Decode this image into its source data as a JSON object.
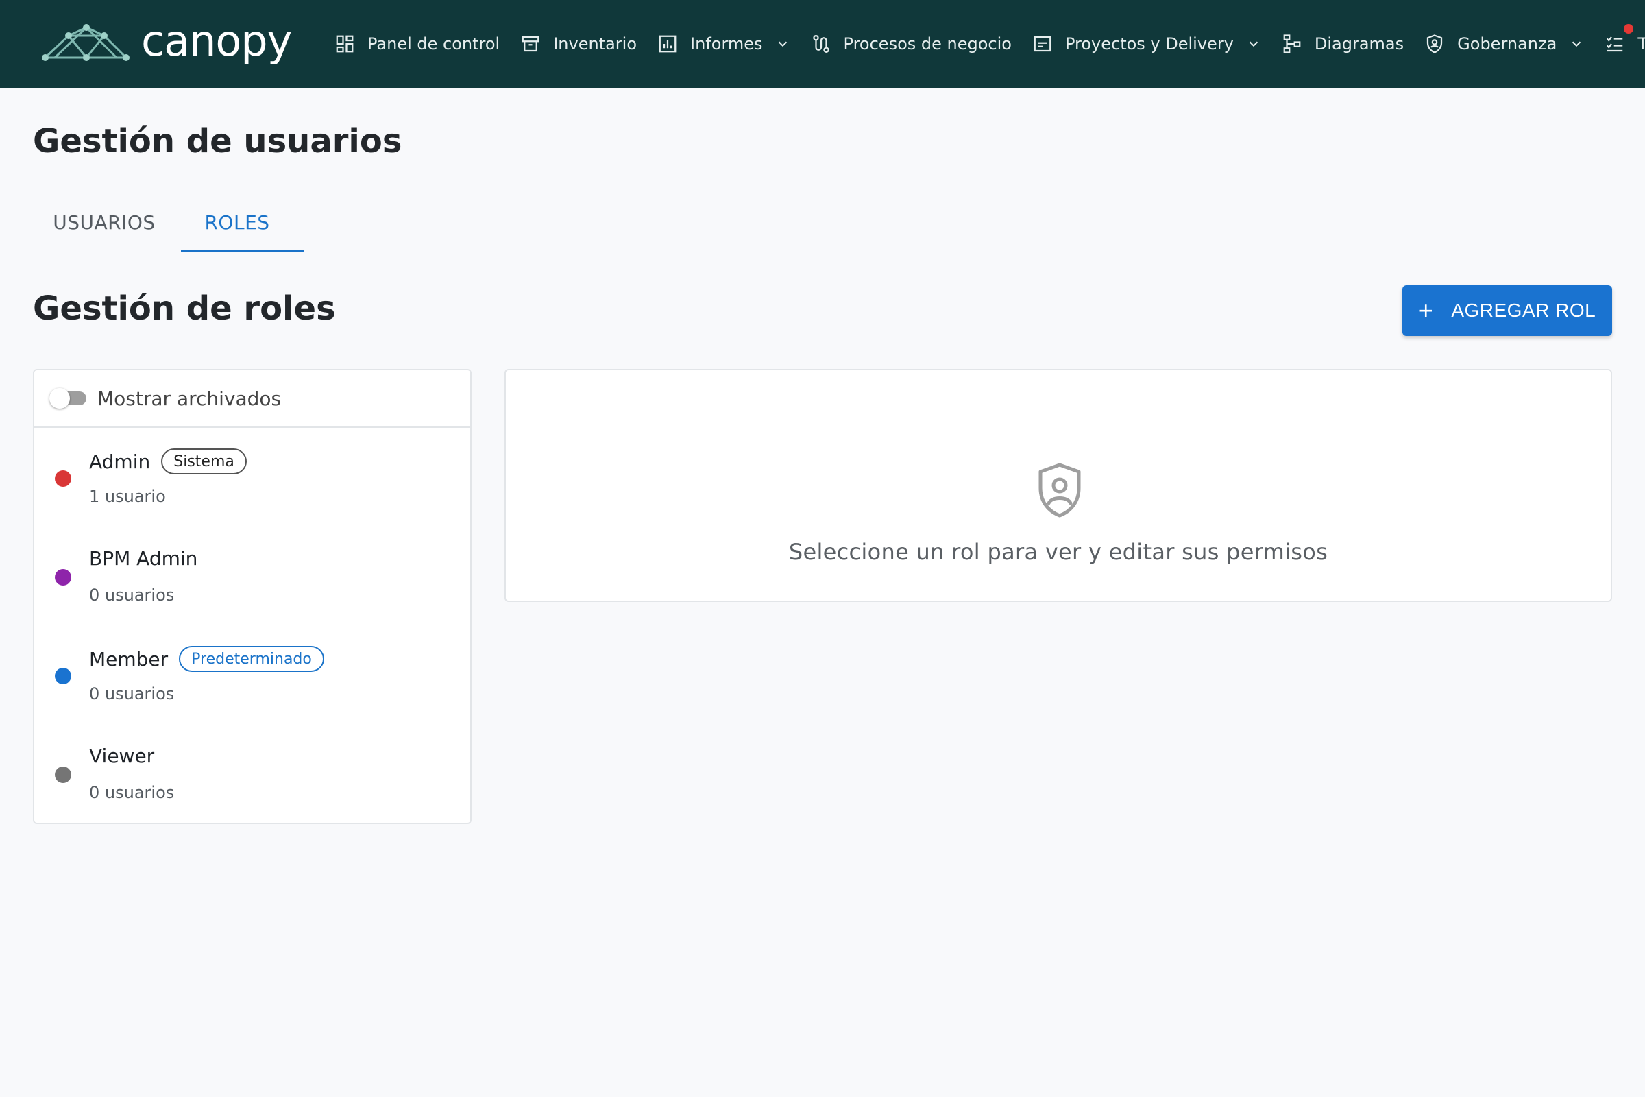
{
  "app": {
    "name": "canopy"
  },
  "nav": {
    "items": [
      {
        "label": "Panel de control",
        "icon": "dashboard-icon",
        "dropdown": false
      },
      {
        "label": "Inventario",
        "icon": "archive-icon",
        "dropdown": false
      },
      {
        "label": "Informes",
        "icon": "bar-chart-icon",
        "dropdown": true
      },
      {
        "label": "Procesos de negocio",
        "icon": "route-icon",
        "dropdown": false
      },
      {
        "label": "Proyectos y Delivery",
        "icon": "project-icon",
        "dropdown": true
      },
      {
        "label": "Diagramas",
        "icon": "tree-diagram-icon",
        "dropdown": false
      },
      {
        "label": "Gobernanza",
        "icon": "shield-icon",
        "dropdown": true
      },
      {
        "label": "Tareas",
        "icon": "checklist-icon",
        "dropdown": false
      }
    ]
  },
  "page": {
    "title": "Gestión de usuarios"
  },
  "tabs": [
    {
      "label": "USUARIOS",
      "active": false
    },
    {
      "label": "ROLES",
      "active": true
    }
  ],
  "roles_section": {
    "title": "Gestión de roles",
    "add_button": "AGREGAR ROL",
    "show_archived": "Mostrar archivados",
    "show_archived_on": false
  },
  "roles": [
    {
      "name": "Admin",
      "badge": "Sistema",
      "badge_style": "neutral",
      "count": "1 usuario",
      "color": "#d93636"
    },
    {
      "name": "BPM Admin",
      "badge": "",
      "badge_style": "",
      "count": "0 usuarios",
      "color": "#8e24aa"
    },
    {
      "name": "Member",
      "badge": "Predeterminado",
      "badge_style": "blue",
      "count": "0 usuarios",
      "color": "#1a73d0"
    },
    {
      "name": "Viewer",
      "badge": "",
      "badge_style": "",
      "count": "0 usuarios",
      "color": "#757575"
    }
  ],
  "detail": {
    "empty_message": "Seleccione un rol para ver y editar sus permisos",
    "icon": "shield-user-icon"
  },
  "colors": {
    "topbar": "#10383a",
    "accent": "#1a73d0"
  }
}
